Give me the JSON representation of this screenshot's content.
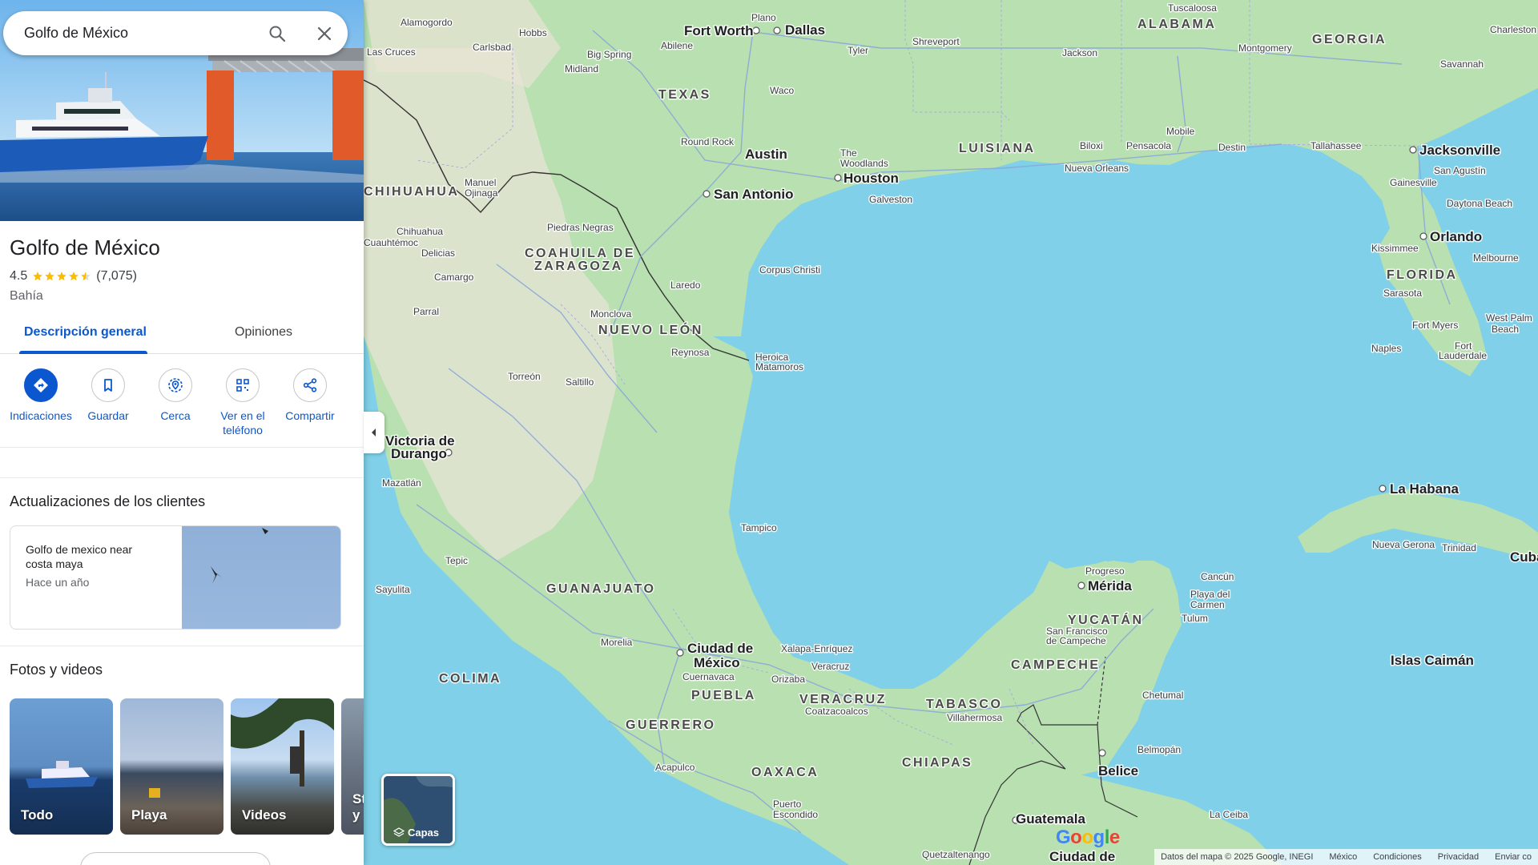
{
  "search": {
    "value": "Golfo de México"
  },
  "place": {
    "title": "Golfo de México",
    "rating": "4.5",
    "rating_value": 4.5,
    "review_count": "(7,075)",
    "category": "Bahía"
  },
  "tabs": [
    {
      "label": "Descripción general",
      "active": true
    },
    {
      "label": "Opiniones",
      "active": false
    }
  ],
  "actions": [
    {
      "label": "Indicaciones",
      "icon": "directions-icon"
    },
    {
      "label": "Guardar",
      "icon": "bookmark-icon"
    },
    {
      "label": "Cerca",
      "icon": "nearby-icon"
    },
    {
      "label": "Ver en el teléfono",
      "icon": "phone-qr-icon"
    },
    {
      "label": "Compartir",
      "icon": "share-icon"
    }
  ],
  "updates": {
    "title": "Actualizaciones de los clientes",
    "card": {
      "text": "Golfo de mexico near costa maya",
      "time": "Hace un año"
    }
  },
  "photos": {
    "title": "Fotos y videos",
    "tiles": [
      {
        "label": "Todo"
      },
      {
        "label": "Playa"
      },
      {
        "label": "Videos"
      },
      {
        "label": "St\ny"
      }
    ]
  },
  "layers": {
    "label": "Capas"
  },
  "footer": {
    "attribution": "Datos del mapa © 2025 Google, INEGI",
    "country": "México",
    "terms": "Condiciones",
    "privacy": "Privacidad",
    "feedback": "Enviar co"
  },
  "colors": {
    "accent": "#0b57d0",
    "water": "#aadaff",
    "land": "#c8e6c0",
    "star": "#fbbc04"
  },
  "map": {
    "regions": [
      "TEXAS",
      "LUISIANA",
      "ALABAMA",
      "GEORGIA",
      "FLORIDA",
      "CHIHUAHUA",
      "COAHUILA DE",
      "ZARAGOZA",
      "NUEVO LEÓN",
      "GUANAJUATO",
      "COLIMA",
      "PUEBLA",
      "VERACRUZ",
      "GUERRERO",
      "OAXACA",
      "CHIAPAS",
      "TABASCO",
      "CAMPECHE",
      "YUCATÁN"
    ],
    "big_cities": [
      "Fort Worth",
      "Dallas",
      "Austin",
      "San Antonio",
      "Houston",
      "Jacksonville",
      "Orlando",
      "La Habana",
      "Mérida",
      "Ciudad de",
      "México",
      "Belice",
      "Guatemala",
      "Ciudad de",
      "Cuba",
      "Islas Caimán",
      "Victoria de",
      "Durango"
    ],
    "cities": [
      "Tuscaloosa",
      "Charleston",
      "Plano",
      "Shreveport",
      "Tyler",
      "Jackson",
      "Montgomery",
      "Savannah",
      "Abilene",
      "Waco",
      "Mobile",
      "Biloxi",
      "Pensacola",
      "Destin",
      "Tallahassee",
      "Round Rock",
      "The",
      "Woodlands",
      "Nueva Orleans",
      "Galveston",
      "San Agustín",
      "Gainesville",
      "Daytona Beach",
      "Kissimmee",
      "Melbourne",
      "Sarasota",
      "Fort Myers",
      "West Palm",
      "Beach",
      "Naples",
      "Fort",
      "Lauderdale",
      "Alamogordo",
      "Hobbs",
      "Las Cruces",
      "Carlsbad",
      "Big Spring",
      "Midland",
      "Manuel",
      "Ojinaga",
      "Chihuahua",
      "Cuauhtémoc",
      "Delicias",
      "Camargo",
      "Piedras Negras",
      "Laredo",
      "Corpus Christi",
      "Parral",
      "Monclova",
      "Reynosa",
      "Heroica",
      "Matamoros",
      "Torreón",
      "Saltillo",
      "Mazatlán",
      "Tampico",
      "Tepic",
      "Sayulita",
      "Morelia",
      "Cuernavaca",
      "Xalapa-Enríquez",
      "Veracruz",
      "Orizaba",
      "Coatzacoalcos",
      "Villahermosa",
      "Acapulco",
      "Puerto",
      "Escondido",
      "Quetzaltenango",
      "Progreso",
      "Cancún",
      "Playa del",
      "Carmen",
      "Tulum",
      "San Francisco",
      "de Campeche",
      "Chetumal",
      "Belmopán",
      "La Ceiba",
      "Nueva Gerona",
      "Trinidad"
    ]
  }
}
